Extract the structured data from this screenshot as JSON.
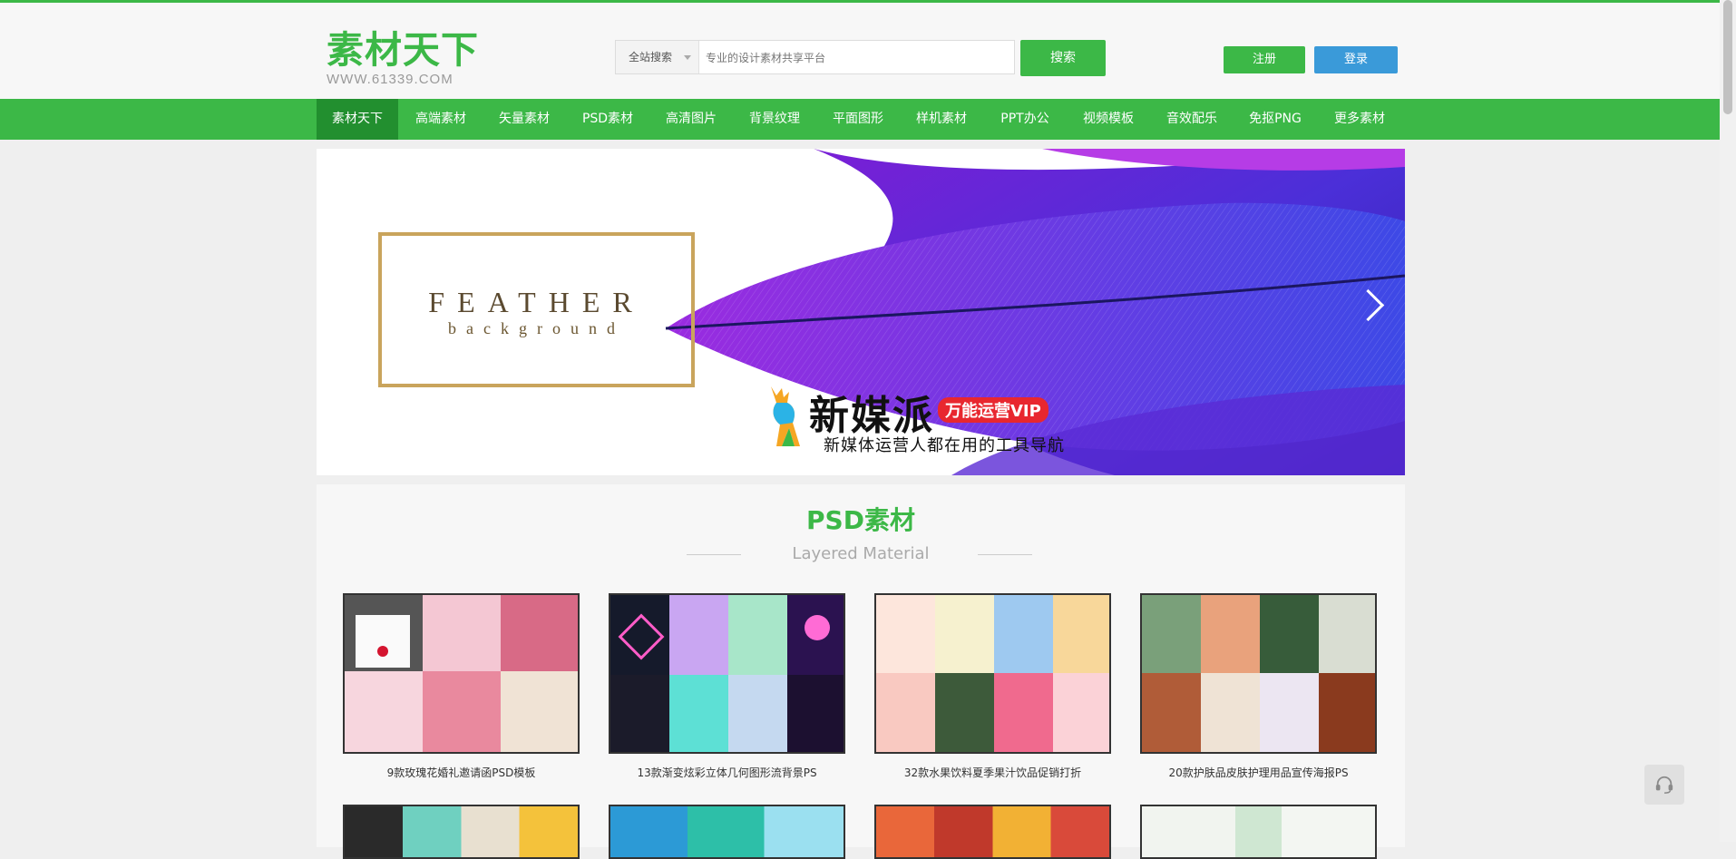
{
  "header": {
    "logo_title": "素材天下",
    "logo_subtitle": "WWW.61339.COM",
    "search_scope": "全站搜索",
    "search_placeholder": "专业的设计素材共享平台",
    "search_button": "搜索",
    "register_button": "注册",
    "login_button": "登录"
  },
  "nav": {
    "items": [
      "素材天下",
      "高端素材",
      "矢量素材",
      "PSD素材",
      "高清图片",
      "背景纹理",
      "平面图形",
      "样机素材",
      "PPT办公",
      "视频模板",
      "音效配乐",
      "免抠PNG",
      "更多素材"
    ],
    "active_index": 0
  },
  "banner": {
    "feather_title": "FEATHER",
    "feather_subtitle": "background",
    "brand_name": "新媒派",
    "brand_tag": "万能运营VIP",
    "brand_slogan": "新媒体运营人都在用的工具导航"
  },
  "section": {
    "title": "PSD素材",
    "subtitle": "Layered Material",
    "cards": [
      {
        "caption": "9款玫瑰花婚礼邀请函PSD模板"
      },
      {
        "caption": "13款渐变炫彩立体几何图形流背景PS"
      },
      {
        "caption": "32款水果饮料夏季果汁饮品促销打折"
      },
      {
        "caption": "20款护肤品皮肤护理用品宣传海报PS"
      }
    ]
  },
  "colors": {
    "brand_green": "#3cb847",
    "nav_active": "#228f2f",
    "login_blue": "#3a9ad9"
  },
  "icons": {
    "help": "headset-icon",
    "next": "chevron-right-icon"
  }
}
